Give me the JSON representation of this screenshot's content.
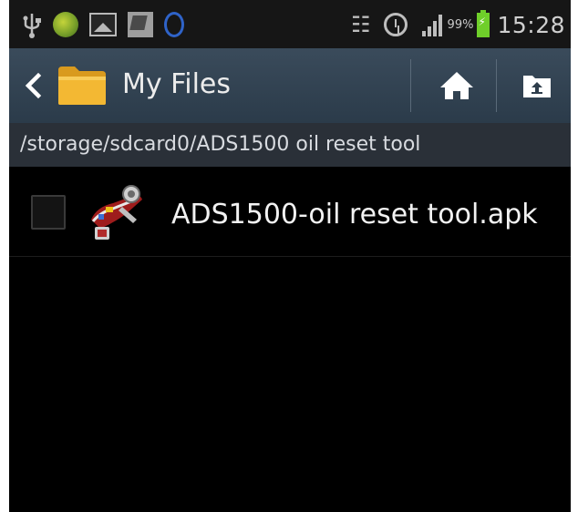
{
  "status_bar": {
    "battery_percent": "99%",
    "time": "15:28",
    "icons": [
      "usb-icon",
      "app-orb-icon",
      "gallery-icon",
      "image-icon",
      "sync-ring-icon",
      "vibrate-icon",
      "alarm-icon",
      "signal-icon",
      "battery-charging-icon"
    ]
  },
  "action_bar": {
    "title": "My Files",
    "back_icon": "chevron-left-icon",
    "folder_icon": "folder-icon",
    "home_icon": "home-icon",
    "up_icon": "folder-up-icon"
  },
  "path_bar": {
    "path": "/storage/sdcard0/ADS1500 oil reset tool"
  },
  "file_list": {
    "items": [
      {
        "name": "ADS1500-oil reset tool.apk",
        "checked": false,
        "icon": "apk-file-icon"
      }
    ]
  },
  "colors": {
    "action_bar": "#33444f",
    "path_bar": "#2a3038",
    "folder": "#f1b431",
    "background": "#000000"
  }
}
